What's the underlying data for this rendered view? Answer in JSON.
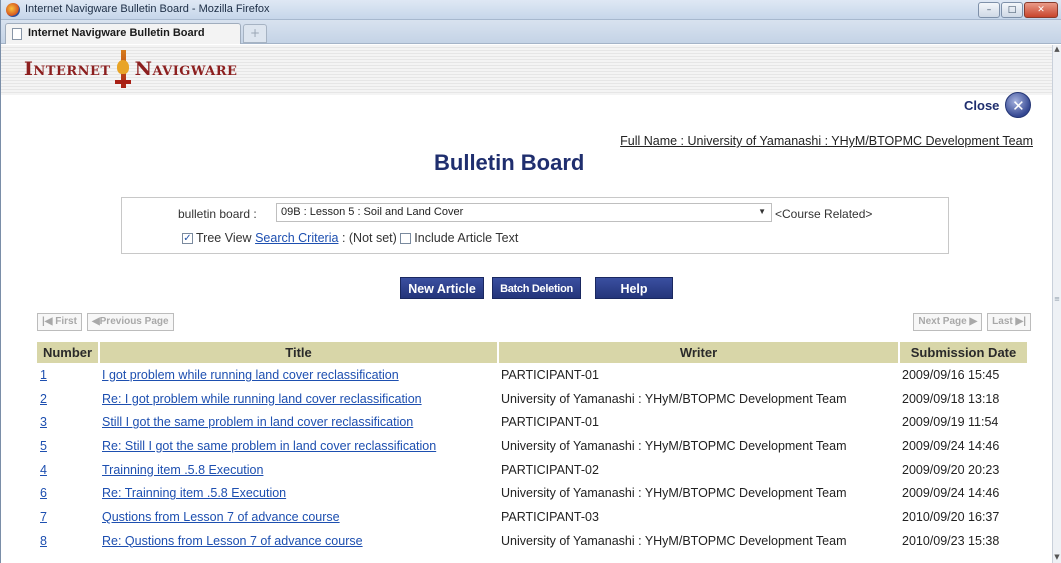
{
  "browser": {
    "window_title": "Internet Navigware Bulletin Board - Mozilla Firefox",
    "tab_title": "Internet Navigware Bulletin Board",
    "new_tab_symbol": "+",
    "minimize_symbol": "–",
    "maximize_symbol": "□",
    "close_symbol": "✕"
  },
  "header": {
    "logo_left": "Internet",
    "logo_right": "Navigware",
    "close_label": "Close",
    "close_symbol": "✕",
    "full_name": "Full Name : University of Yamanashi : YHyM/BTOPMC Development Team",
    "page_title": "Bulletin Board"
  },
  "filter": {
    "board_label": "bulletin board :",
    "board_selected": "09B : Lesson 5 : Soil and Land Cover",
    "board_dropdown_arrow": "▼",
    "course_related": "<Course Related>",
    "tree_view_checked": true,
    "tree_view_label": "Tree View",
    "search_criteria_link": "Search Criteria",
    "search_criteria_status": ": (Not set)",
    "include_article_text_checked": false,
    "include_article_text_label": "Include Article Text"
  },
  "actions": {
    "new_article": "New Article",
    "batch_deletion": "Batch Deletion",
    "help": "Help"
  },
  "pager": {
    "first": "|◀ First",
    "previous": "◀Previous Page",
    "next": "Next Page ▶",
    "last": "Last ▶|"
  },
  "table": {
    "columns": [
      "Number",
      "Title",
      "Writer",
      "Submission Date"
    ],
    "rows": [
      {
        "number": "1",
        "title": "I got problem while running land cover reclassification",
        "writer": "PARTICIPANT-01",
        "date": "2009/09/16 15:45",
        "reply": false
      },
      {
        "number": "2",
        "title": "Re: I got problem while running land cover reclassification",
        "writer": "University of Yamanashi : YHyM/BTOPMC Development Team",
        "date": "2009/09/18 13:18",
        "reply": true
      },
      {
        "number": "3",
        "title": "Still I got the same problem in land cover reclassification",
        "writer": "PARTICIPANT-01",
        "date": "2009/09/19 11:54",
        "reply": false
      },
      {
        "number": "5",
        "title": "Re: Still I got the same problem in land cover reclassification",
        "writer": "University of Yamanashi : YHyM/BTOPMC Development Team",
        "date": "2009/09/24 14:46",
        "reply": true
      },
      {
        "number": "4",
        "title": "Trainning item .5.8 Execution",
        "writer": "PARTICIPANT-02",
        "date": "2009/09/20 20:23",
        "reply": false
      },
      {
        "number": "6",
        "title": "Re: Trainning item .5.8 Execution",
        "writer": "University of Yamanashi : YHyM/BTOPMC Development Team",
        "date": "2009/09/24 14:46",
        "reply": true
      },
      {
        "number": "7",
        "title": "Qustions from Lesson 7 of advance course",
        "writer": "PARTICIPANT-03",
        "date": "2010/09/20 16:37",
        "reply": false
      },
      {
        "number": "8",
        "title": "Re: Qustions from Lesson 7 of advance course",
        "writer": "University of Yamanashi : YHyM/BTOPMC Development Team",
        "date": "2010/09/23 15:38",
        "reply": true
      }
    ]
  },
  "icons": {
    "browser": "firefox-icon",
    "tab": "page-icon",
    "close": "close-circle-icon",
    "logo": "navigware-flame-icon"
  }
}
